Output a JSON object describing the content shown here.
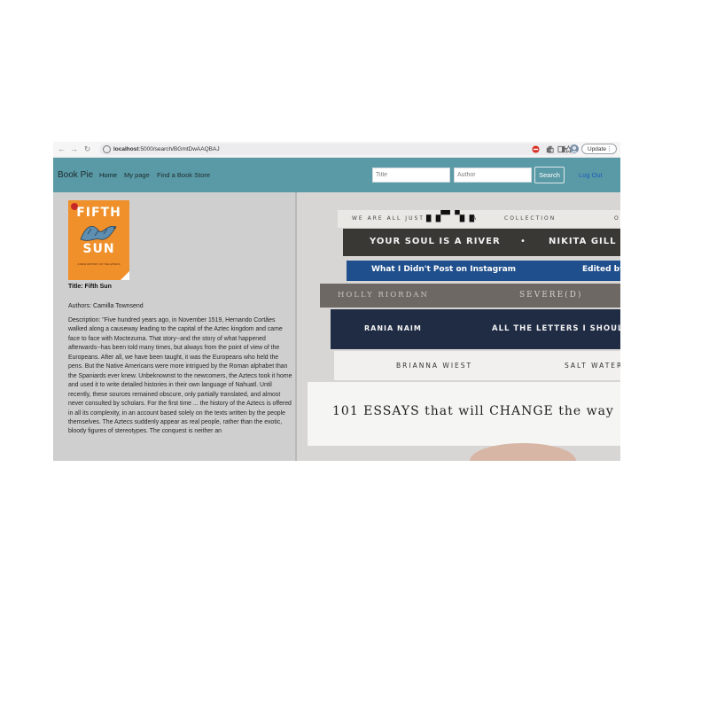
{
  "browser": {
    "url_host": "localhost",
    "url_path": ":5000/search/BGmtDwAAQBAJ",
    "update_label": "Update",
    "more_label": "⋮"
  },
  "navbar": {
    "brand": "Book Pie",
    "links": [
      "Home",
      "My page",
      "Find a Book Store"
    ],
    "title_placeholder": "Title",
    "author_placeholder": "Author",
    "search_label": "Search",
    "logout_label": "Log Out"
  },
  "book": {
    "cover_title_line1": "FIFTH",
    "cover_title_line2": "SUN",
    "cover_subtitle": "A NEW HISTORY OF THE AZTECS",
    "title": "Title: Fifth Sun",
    "authors": "Authors: Camilla Townsend",
    "description": "Description: \"Five hundred years ago, in November 1519, Hernando Cortães walked along a causeway leading to the capital of the Aztec kingdom and came face to face with Moctezuma. That story--and the story of what happened afterwards--has been told many times, but always from the point of view of the Europeans. After all, we have been taught, it was the Europeans who held the pens. But the Native Americans were more intrigued by the Roman alphabet than the Spaniards ever knew. Unbeknownst to the newcomers, the Aztecs took it home and used it to write detailed histories in their own language of Nahuatl. Until recently, these sources remained obscure, only partially translated, and almost never consulted by scholars. For the first time ... the history of the Aztecs is offered in all its complexity, in an account based solely on the texts written by the people themselves. The Aztecs suddenly appear as real people, rather than the exotic, bloody figures of stereotypes. The conquest is neither an"
  },
  "hero": {
    "books": [
      {
        "left": "WE ARE ALL JUST",
        "mid": "A",
        "right": "COLLECTION",
        "far": "OF"
      },
      {
        "left": "YOUR SOUL IS A RIVER",
        "mid": "•",
        "right": "NIKITA GILL"
      },
      {
        "left": "What I Didn't Post on Instagram",
        "right": "Edited by"
      },
      {
        "left": "HOLLY RIORDAN",
        "right": "SEVERE(D)"
      },
      {
        "left": "RANIA NAIM",
        "right": "ALL THE LETTERS I SHOULD"
      },
      {
        "left": "BRIANNA WIEST",
        "right": "SALT WATER"
      },
      {
        "left": "101 ESSAYS that will CHANGE the way"
      }
    ]
  }
}
